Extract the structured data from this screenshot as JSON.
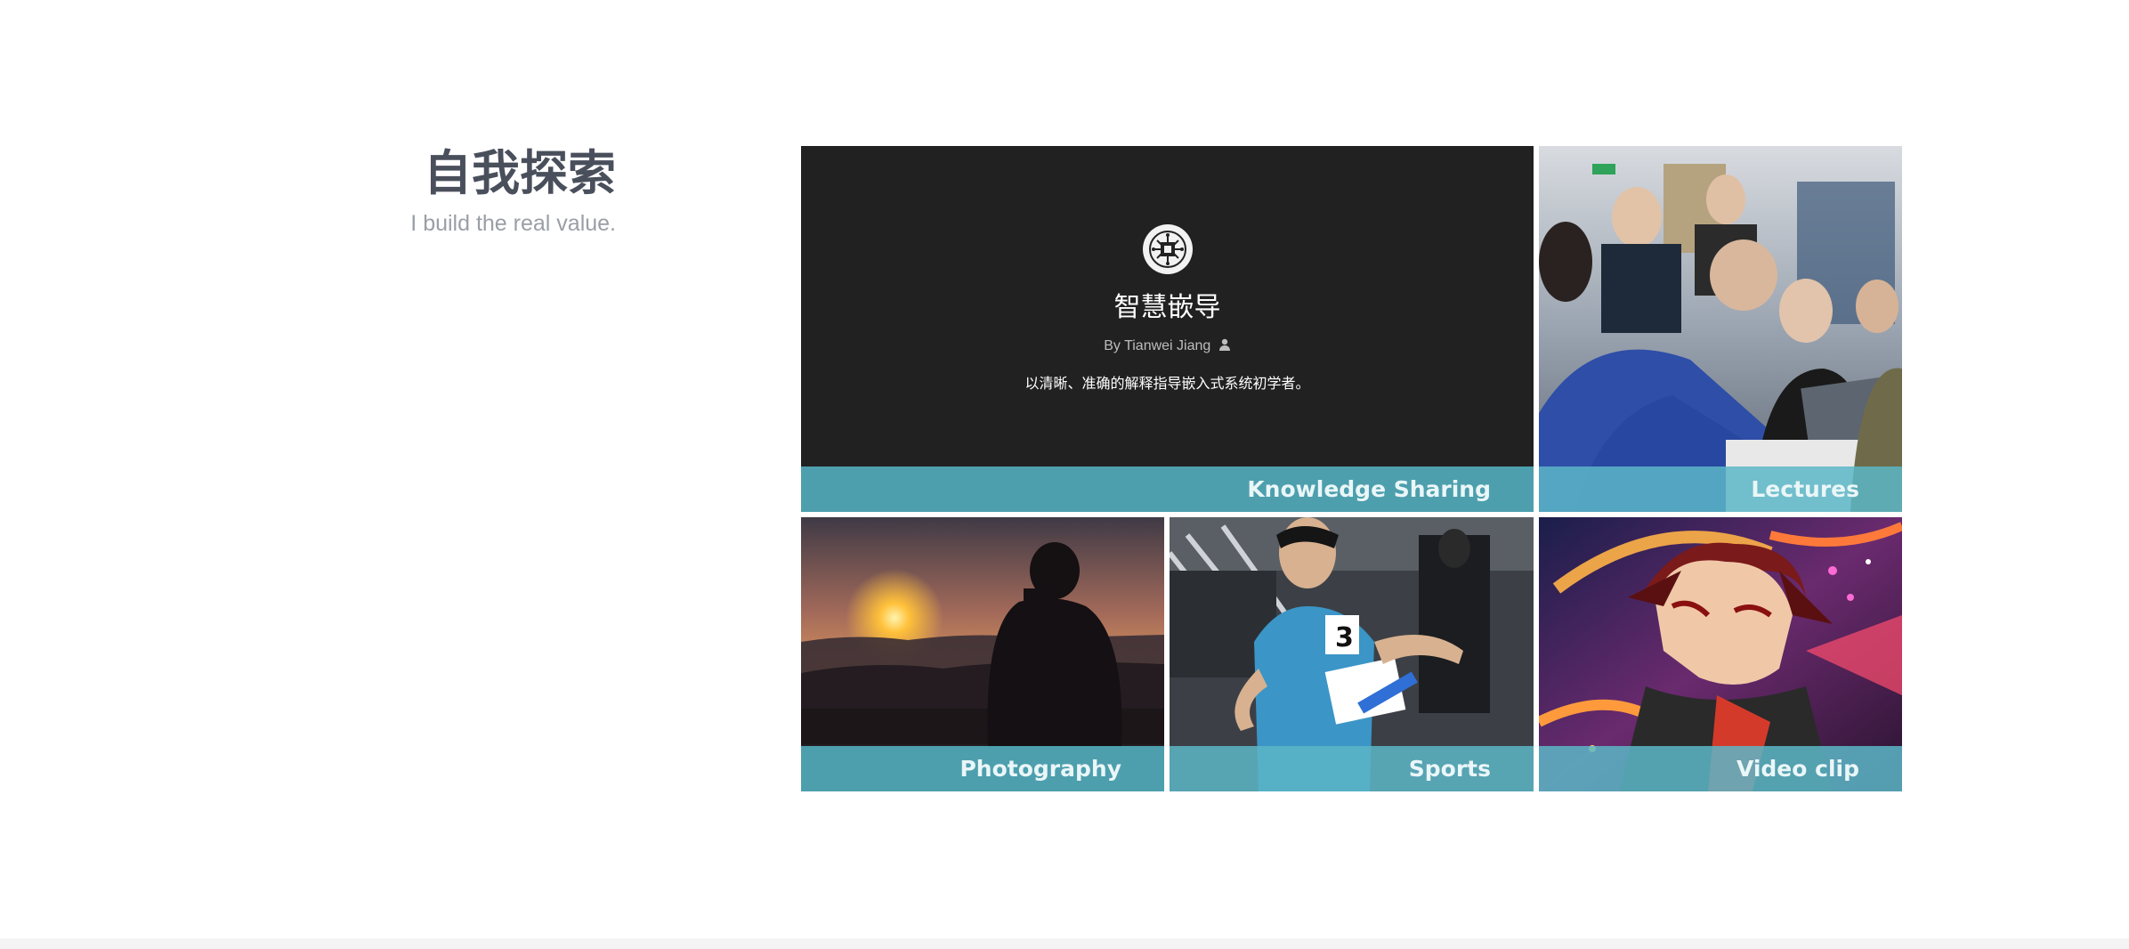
{
  "header": {
    "title": "自我探索",
    "subtitle": "I build the real value."
  },
  "tiles": {
    "knowledge": {
      "site_title": "智慧嵌导",
      "author": "By Tianwei Jiang",
      "description": "以清晰、准确的解释指导嵌入式系统初学者。",
      "caption": "Knowledge Sharing"
    },
    "lectures": {
      "caption": "Lectures"
    },
    "photography": {
      "caption": "Photography"
    },
    "sports": {
      "caption": "Sports"
    },
    "video": {
      "caption": "Video clip"
    }
  },
  "colors": {
    "caption_bg": "#5cb6c7",
    "dark_tile": "#212121",
    "heading": "#4a4f5c",
    "subheading": "#9a9ea6"
  },
  "icons": {
    "author": "user-icon",
    "logo": "circuit-logo-icon"
  }
}
